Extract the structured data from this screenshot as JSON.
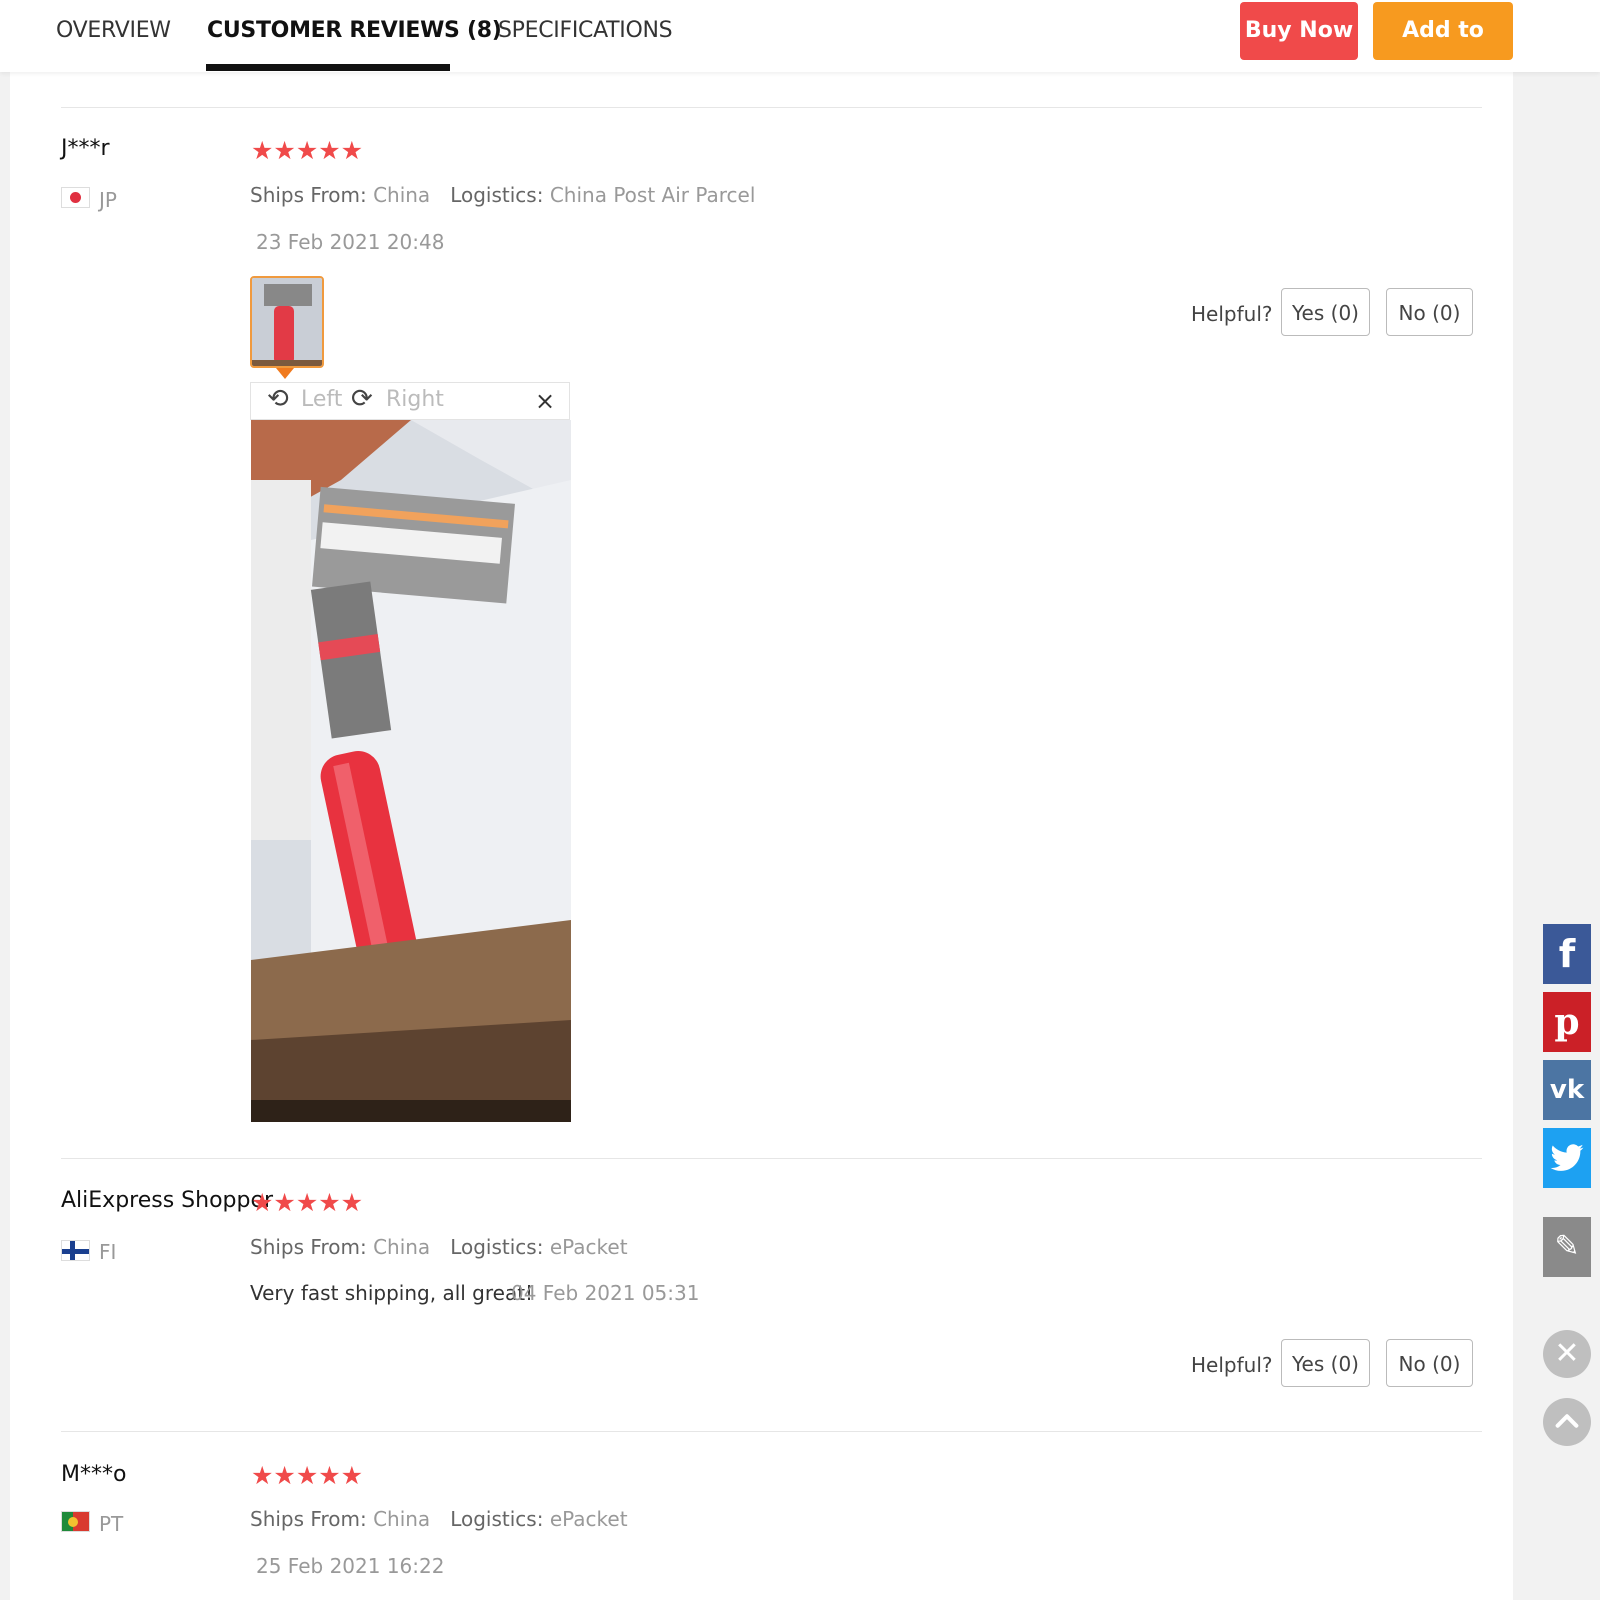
{
  "nav": {
    "tabs": [
      "OVERVIEW",
      "CUSTOMER REVIEWS (8)",
      "SPECIFICATIONS"
    ],
    "active_tab": "CUSTOMER REVIEWS (8)",
    "buy_now": "Buy Now",
    "add_to_cart": "Add to Cart"
  },
  "colors": {
    "accent_red": "#f04a4a",
    "accent_orange": "#f79a1f",
    "star": "#f04a4a"
  },
  "review_labels": {
    "ships_from": "Ships From:",
    "logistics": "Logistics:",
    "helpful": "Helpful?",
    "yes": "Yes (0)",
    "no": "No (0)"
  },
  "viewer": {
    "rotate_left": "Left",
    "rotate_right": "Right",
    "close": "×"
  },
  "reviews": [
    {
      "name": "J***r",
      "country": "JP",
      "stars": 5,
      "ships_from": "China",
      "logistics": "China Post Air Parcel",
      "text": "",
      "date": "23 Feb 2021 20:48",
      "has_photo": true
    },
    {
      "name": "AliExpress Shopper",
      "country": "FI",
      "stars": 5,
      "ships_from": "China",
      "logistics": "ePacket",
      "text": "Very fast shipping, all great!",
      "date": "04 Feb 2021 05:31",
      "has_photo": false
    },
    {
      "name": "M***o",
      "country": "PT",
      "stars": 5,
      "ships_from": "China",
      "logistics": "ePacket",
      "text": "",
      "date": "25 Feb 2021 16:22",
      "has_photo": false
    }
  ],
  "stars_glyph": "★★★★★",
  "side_icons": [
    "facebook-icon",
    "pinterest-icon",
    "vk-icon",
    "twitter-icon",
    "edit-icon",
    "close-icon",
    "scroll-top-icon"
  ]
}
